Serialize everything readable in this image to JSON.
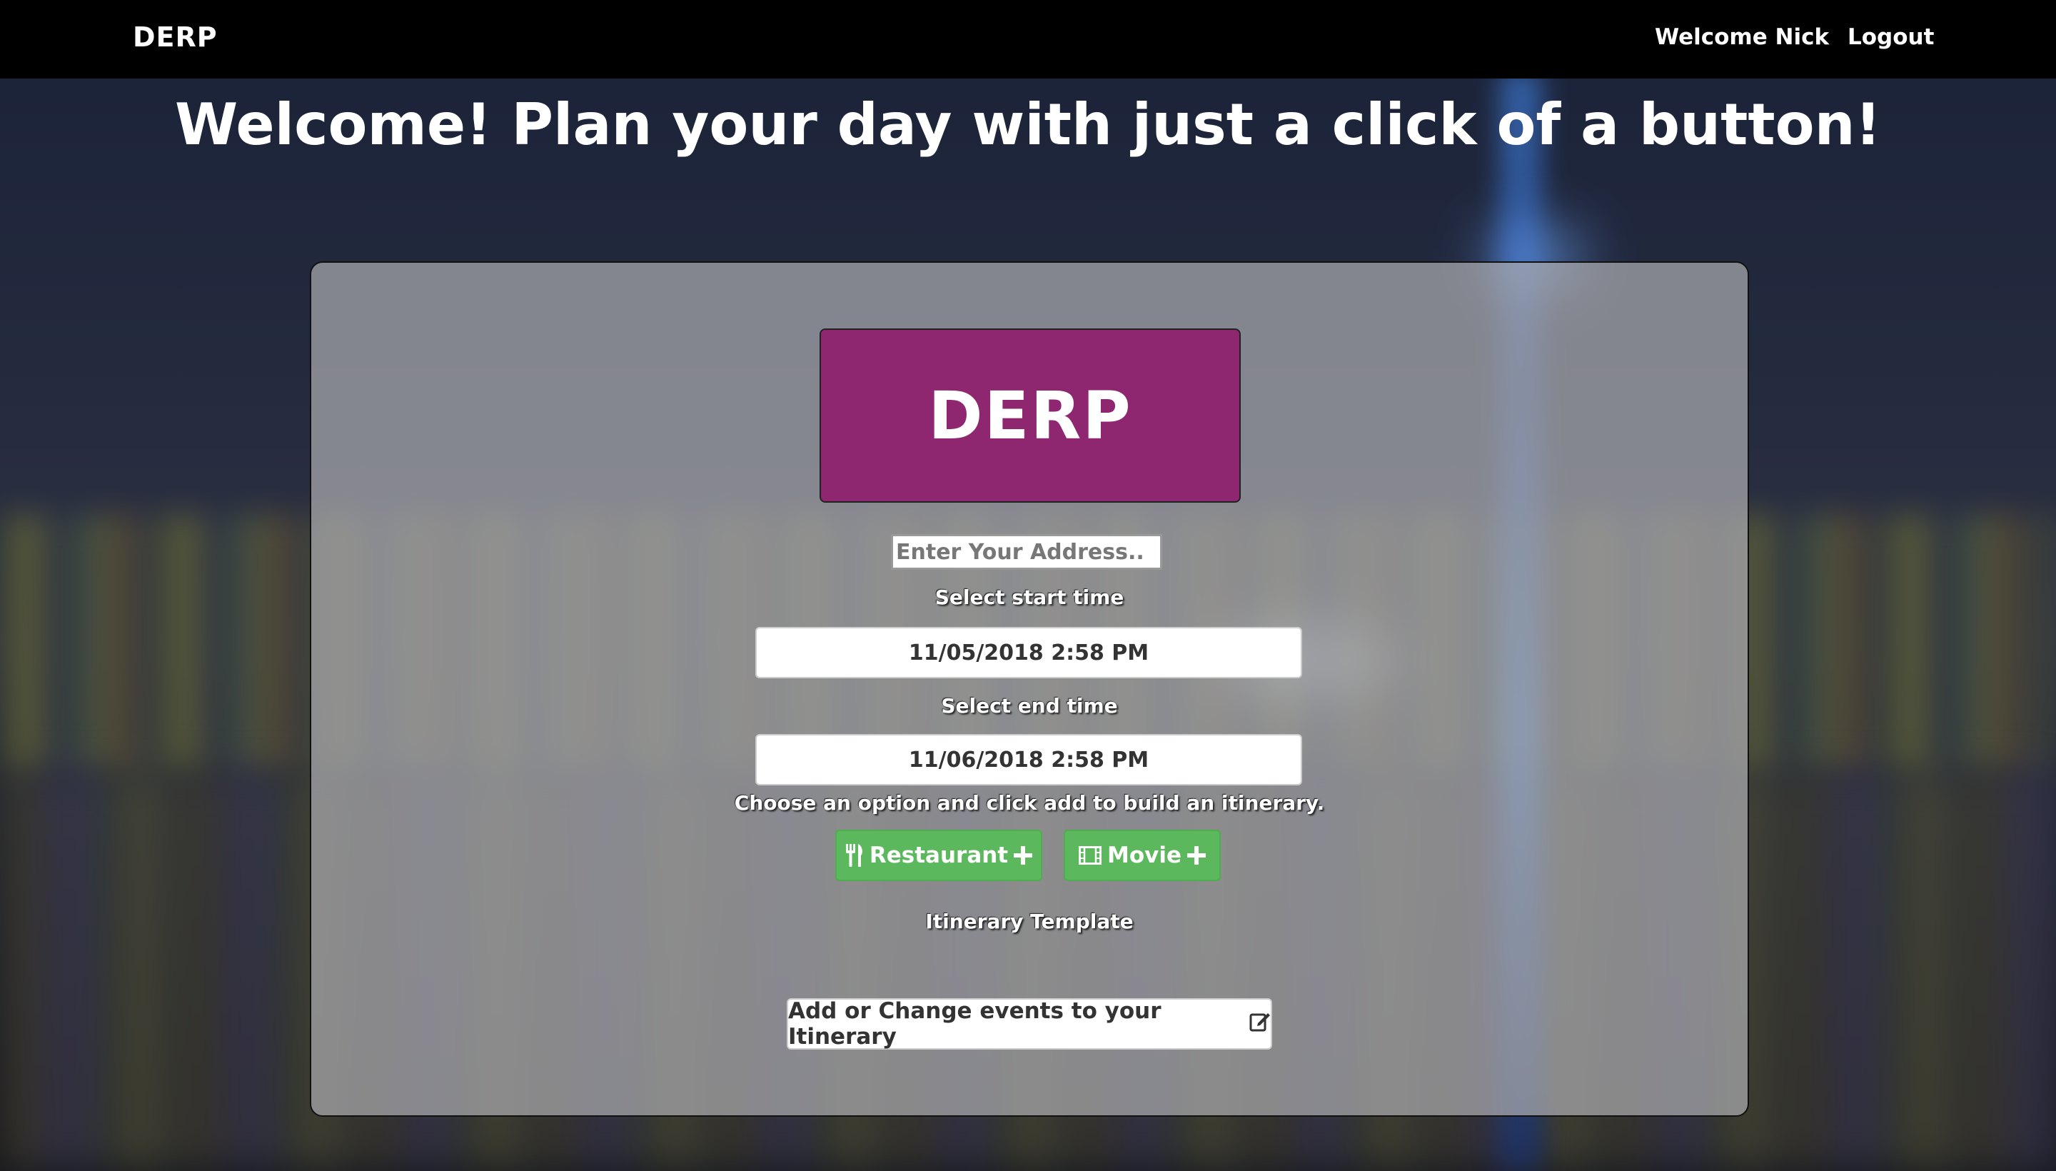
{
  "nav": {
    "brand": "DERP",
    "welcome": "Welcome Nick",
    "logout": "Logout"
  },
  "headline": "Welcome! Plan your day with just a click of a button!",
  "panel": {
    "logo_text": "DERP",
    "address_placeholder": "Enter Your Address..",
    "start_label": "Select start time",
    "start_value": "11/05/2018 2:58 PM",
    "end_label": "Select end time",
    "end_value": "11/06/2018 2:58 PM",
    "instructions": "Choose an option and click add to build an itinerary.",
    "restaurant_button": "Restaurant",
    "movie_button": "Movie",
    "itinerary_heading": "Itinerary Template",
    "change_events_button": "Add or Change events to your Itinerary"
  },
  "colors": {
    "brand_purple": "#8f2770",
    "button_green": "#5cb85c",
    "navbar": "#000000"
  },
  "icons": [
    "utensils-icon",
    "plus-icon",
    "film-icon",
    "edit-icon"
  ]
}
